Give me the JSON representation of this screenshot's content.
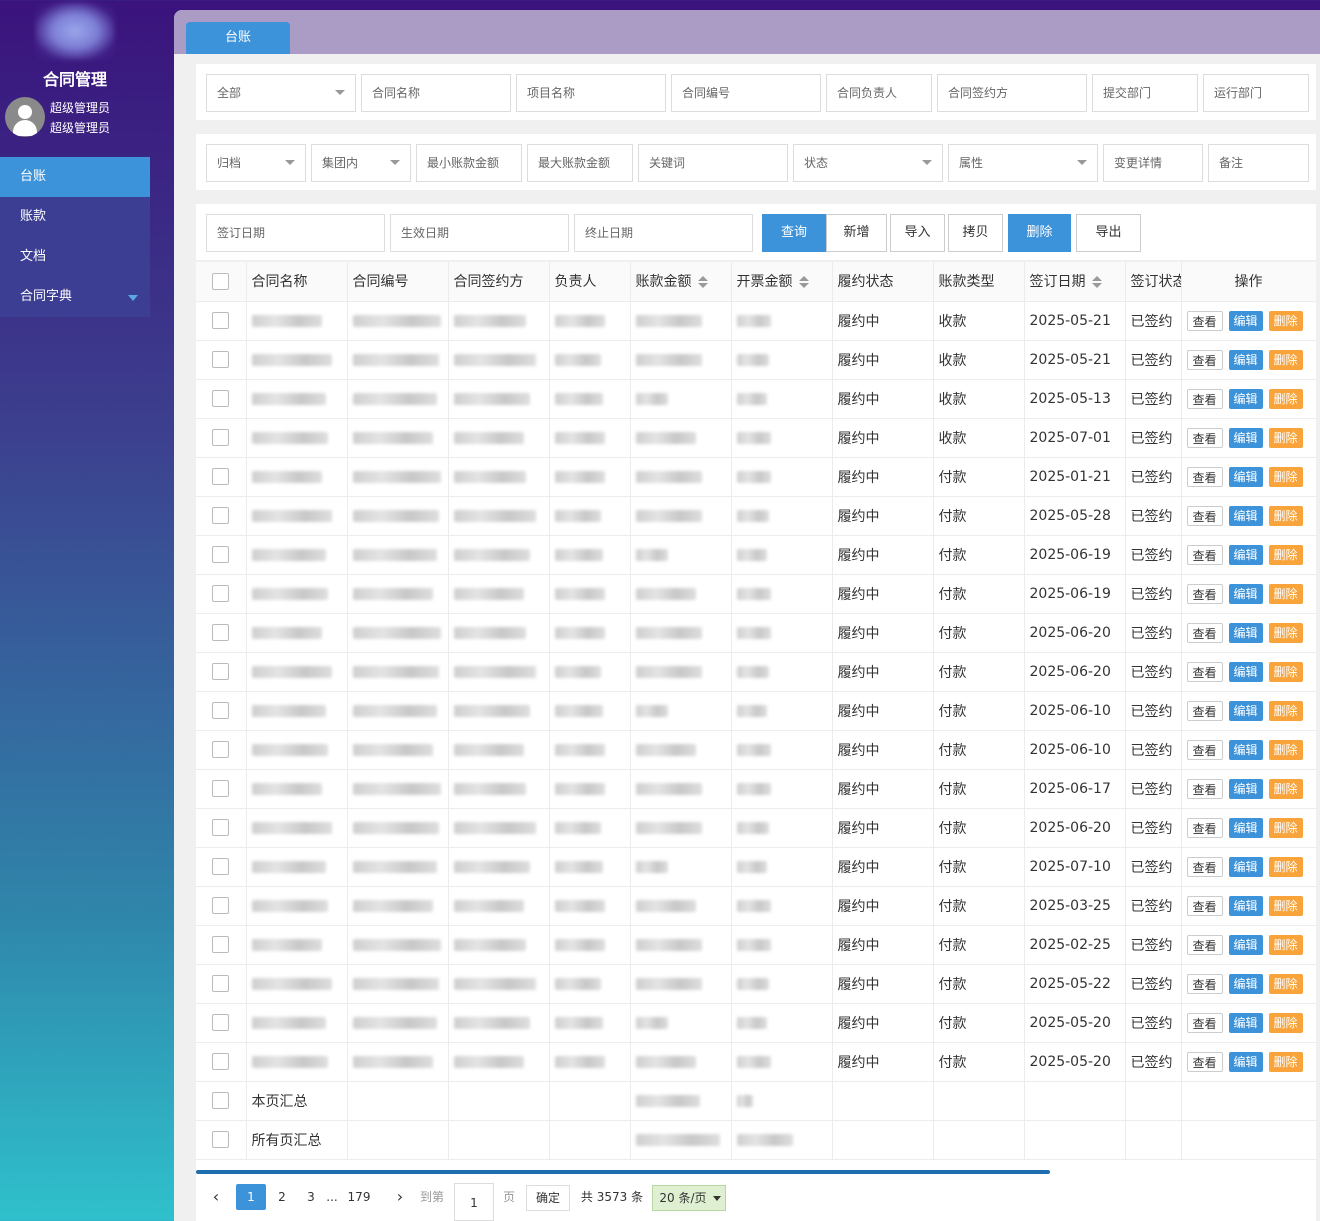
{
  "sidebar": {
    "title": "合同管理",
    "user_line1": "超级管理员",
    "user_line2": "超级管理员",
    "nav": [
      {
        "label": "台账",
        "active": true
      },
      {
        "label": "账款"
      },
      {
        "label": "文档"
      },
      {
        "label": "合同字典",
        "has_caret": true
      }
    ]
  },
  "tab": {
    "label": "台账"
  },
  "filters_row1": {
    "scope": "全部",
    "contract_name": "合同名称",
    "project_name": "项目名称",
    "contract_no": "合同编号",
    "owner": "合同负责人",
    "signatory": "合同签约方",
    "submit_dept": "提交部门",
    "run_dept": "运行部门"
  },
  "filters_row2": {
    "archive": "归档",
    "group": "集团内",
    "min_amount": "最小账款金额",
    "max_amount": "最大账款金额",
    "keyword": "关键词",
    "status": "状态",
    "attribute": "属性",
    "change_detail": "变更详情",
    "remark": "备注"
  },
  "filters_row3": {
    "sign_date": "签订日期",
    "effective_date": "生效日期",
    "end_date": "终止日期"
  },
  "actions": {
    "query": "查询",
    "add": "新增",
    "import": "导入",
    "copy": "拷贝",
    "delete": "删除",
    "export": "导出"
  },
  "table": {
    "headers": [
      "合同名称",
      "合同编号",
      "合同签约方",
      "负责人",
      "账款金额",
      "开票金额",
      "履约状态",
      "账款类型",
      "签订日期",
      "签订状态",
      "操作"
    ],
    "op_labels": {
      "view": "查看",
      "edit": "编辑",
      "delete": "删除"
    },
    "rows": [
      {
        "status": "履约中",
        "type": "收款",
        "date": "2025-05-21",
        "sign": "已签约"
      },
      {
        "status": "履约中",
        "type": "收款",
        "date": "2025-05-21",
        "sign": "已签约"
      },
      {
        "status": "履约中",
        "type": "收款",
        "date": "2025-05-13",
        "sign": "已签约"
      },
      {
        "status": "履约中",
        "type": "收款",
        "date": "2025-07-01",
        "sign": "已签约"
      },
      {
        "status": "履约中",
        "type": "付款",
        "date": "2025-01-21",
        "sign": "已签约"
      },
      {
        "status": "履约中",
        "type": "付款",
        "date": "2025-05-28",
        "sign": "已签约"
      },
      {
        "status": "履约中",
        "type": "付款",
        "date": "2025-06-19",
        "sign": "已签约"
      },
      {
        "status": "履约中",
        "type": "付款",
        "date": "2025-06-19",
        "sign": "已签约"
      },
      {
        "status": "履约中",
        "type": "付款",
        "date": "2025-06-20",
        "sign": "已签约"
      },
      {
        "status": "履约中",
        "type": "付款",
        "date": "2025-06-20",
        "sign": "已签约"
      },
      {
        "status": "履约中",
        "type": "付款",
        "date": "2025-06-10",
        "sign": "已签约"
      },
      {
        "status": "履约中",
        "type": "付款",
        "date": "2025-06-10",
        "sign": "已签约"
      },
      {
        "status": "履约中",
        "type": "付款",
        "date": "2025-06-17",
        "sign": "已签约"
      },
      {
        "status": "履约中",
        "type": "付款",
        "date": "2025-06-20",
        "sign": "已签约"
      },
      {
        "status": "履约中",
        "type": "付款",
        "date": "2025-07-10",
        "sign": "已签约"
      },
      {
        "status": "履约中",
        "type": "付款",
        "date": "2025-03-25",
        "sign": "已签约"
      },
      {
        "status": "履约中",
        "type": "付款",
        "date": "2025-02-25",
        "sign": "已签约"
      },
      {
        "status": "履约中",
        "type": "付款",
        "date": "2025-05-22",
        "sign": "已签约"
      },
      {
        "status": "履约中",
        "type": "付款",
        "date": "2025-05-20",
        "sign": "已签约"
      },
      {
        "status": "履约中",
        "type": "付款",
        "date": "2025-05-20",
        "sign": "已签约"
      }
    ],
    "summary_page": "本页汇总",
    "summary_all": "所有页汇总"
  },
  "pager": {
    "pages": [
      "1",
      "2",
      "3",
      "...",
      "179"
    ],
    "goto_label": "到第",
    "goto_value": "1",
    "page_unit": "页",
    "confirm": "确定",
    "total": "共 3573 条",
    "page_size": "20 条/页"
  },
  "colors": {
    "primary": "#3d93da",
    "delete": "#f9a43b",
    "tabbar": "#ab9cc6"
  }
}
